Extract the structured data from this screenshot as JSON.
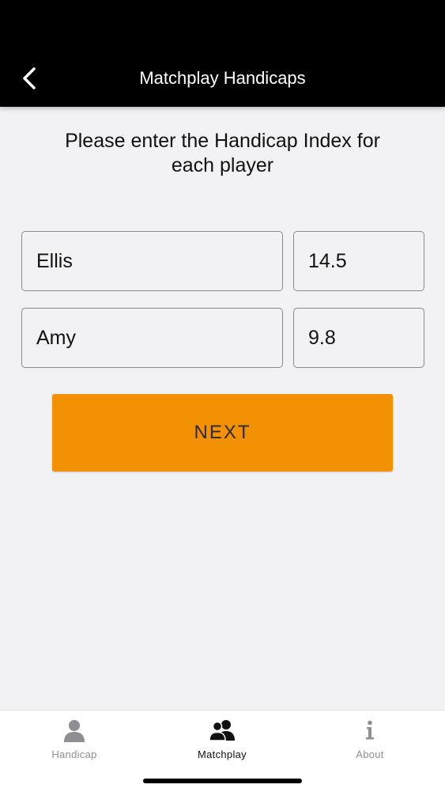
{
  "header": {
    "title": "Matchplay Handicaps",
    "back_icon": "chevron-left-icon",
    "background_color": "#000000"
  },
  "main": {
    "instructions": "Please enter the Handicap Index for each player",
    "players": [
      {
        "name": "Ellis",
        "handicap": "14.5"
      },
      {
        "name": "Amy",
        "handicap": "9.8"
      }
    ],
    "next_label": "NEXT",
    "accent_color": "#f39104"
  },
  "tabbar": {
    "tabs": [
      {
        "label": "Handicap",
        "icon": "person-icon",
        "active": false
      },
      {
        "label": "Matchplay",
        "icon": "people-icon",
        "active": true
      },
      {
        "label": "About",
        "icon": "info-icon",
        "active": false
      }
    ]
  }
}
